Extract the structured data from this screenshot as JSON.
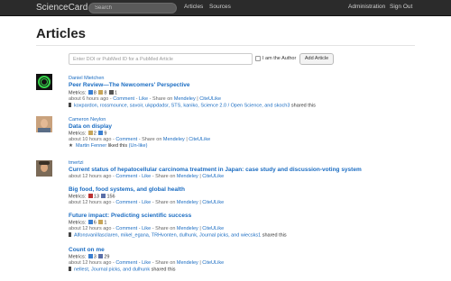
{
  "topbar": {
    "brand": "ScienceCard",
    "search_placeholder": "Search",
    "nav": [
      "Articles",
      "Sources"
    ],
    "right": [
      "Administration",
      "Sign Out"
    ]
  },
  "page": {
    "title": "Articles",
    "doi_placeholder": "Enter DOI or PubMed ID for a PubMed Article",
    "author_label": "I am the Author",
    "add_button": "Add Article"
  },
  "entries": [
    {
      "user": "Daniel Mietchen",
      "avatar": "green-circle-avatar",
      "articles": [
        {
          "title": "Peer Review—The Newcomers' Perspective",
          "metrics_label": "Metrics:",
          "metrics": [
            {
              "icon": "mendeley-icon",
              "value": "8"
            },
            {
              "icon": "citeulike-icon",
              "value": "8"
            },
            {
              "icon": "twitter-icon",
              "value": "1"
            }
          ],
          "time": "about 6 hours ago",
          "share_label": "Share on",
          "links": [
            "Comment",
            "Like",
            "Mendeley",
            "CiteULike"
          ],
          "shared_by": "koxpardon, rossmounce, savoir, ukppdadsr, STS, kaniko, Science 2.0 / Open Science, and skoch3",
          "shared_suffix": "shared this"
        }
      ]
    },
    {
      "user": "Cameron Neylon",
      "avatar": "photo-avatar",
      "articles": [
        {
          "title": "Data on display",
          "metrics_label": "Metrics:",
          "metrics": [
            {
              "icon": "citeulike-icon",
              "value": "2"
            },
            {
              "icon": "mendeley-icon",
              "value": "9"
            }
          ],
          "time": "about 10 hours ago",
          "share_label": "Share on",
          "links": [
            "Comment",
            "Mendeley",
            "CiteULike"
          ],
          "liked_by": "Martin Fenner",
          "liked_suffix": "liked this",
          "unlike": "(Un-like)"
        }
      ]
    },
    {
      "user": "tmertzi",
      "avatar": "photo-avatar",
      "articles": [
        {
          "title": "Current status of hepatocellular carcinoma treatment in Japan: case study and discussion-voting system",
          "time": "about 12 hours ago",
          "share_label": "Share on",
          "links": [
            "Comment",
            "Like",
            "Mendeley",
            "CiteULike"
          ]
        },
        {
          "title": "Big food, food systems, and global health",
          "metrics_label": "Metrics:",
          "metrics": [
            {
              "icon": "scopus-icon",
              "value": "13"
            },
            {
              "icon": "facebook-icon",
              "value": "156"
            }
          ],
          "time": "about 12 hours ago",
          "share_label": "Share on",
          "links": [
            "Comment",
            "Like",
            "Mendeley",
            "CiteULike"
          ]
        },
        {
          "title": "Future impact: Predicting scientific success",
          "metrics_label": "Metrics:",
          "metrics": [
            {
              "icon": "mendeley-icon",
              "value": "6"
            },
            {
              "icon": "citeulike-icon",
              "value": "1"
            }
          ],
          "time": "about 12 hours ago",
          "share_label": "Share on",
          "links": [
            "Comment",
            "Like",
            "Mendeley",
            "CiteULike"
          ],
          "shared_by": "Alfonsvanillasclaren, mikel_egana, TRHvonten, dulhunk, Journal picks, and wiecsks1",
          "shared_suffix": "shared this"
        },
        {
          "title": "Count on me",
          "metrics_label": "Metrics:",
          "metrics": [
            {
              "icon": "mendeley-icon",
              "value": "3"
            },
            {
              "icon": "facebook-icon",
              "value": "29"
            }
          ],
          "time": "about 12 hours ago",
          "share_label": "Share on",
          "links": [
            "Comment",
            "Like",
            "Mendeley",
            "CiteULike"
          ],
          "shared_by": "nellest, Journal picks, and dulhunk",
          "shared_suffix": "shared this"
        }
      ]
    }
  ],
  "separator": "-",
  "pipe": "|"
}
